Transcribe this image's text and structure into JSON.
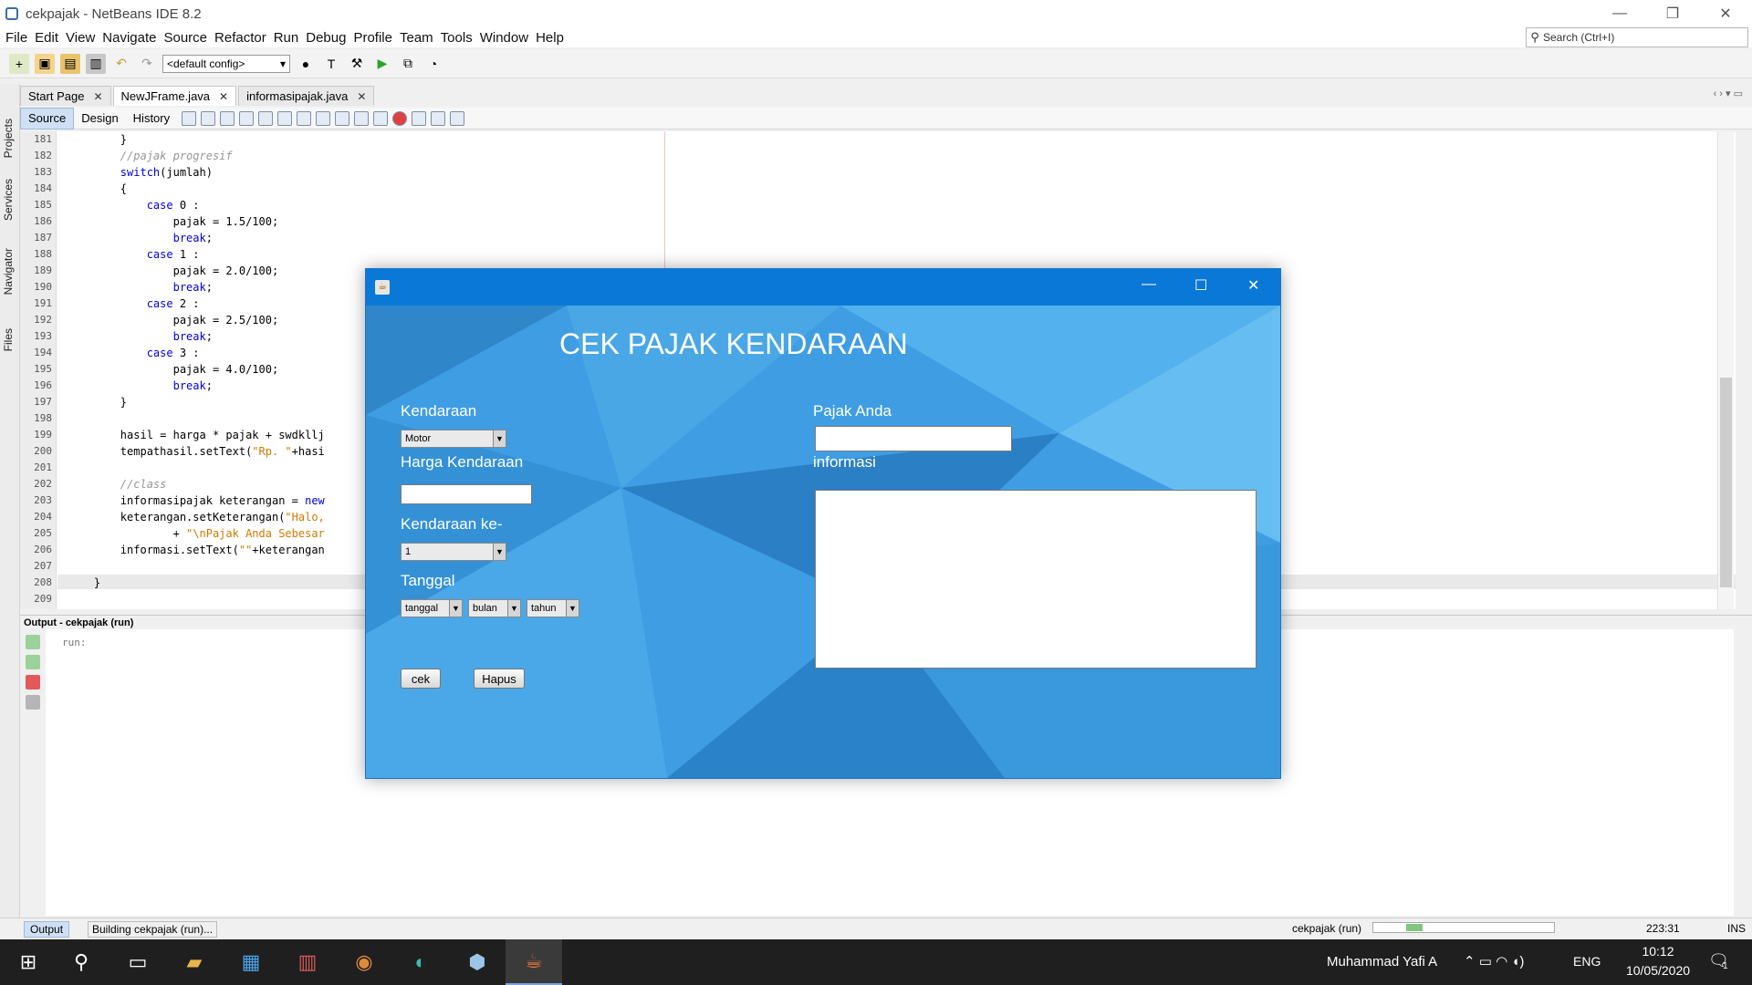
{
  "window": {
    "title": "cekpajak - NetBeans IDE 8.2",
    "minimize": "—",
    "restore": "❐",
    "close": "✕"
  },
  "menu": [
    "File",
    "Edit",
    "View",
    "Navigate",
    "Source",
    "Refactor",
    "Run",
    "Debug",
    "Profile",
    "Team",
    "Tools",
    "Window",
    "Help"
  ],
  "search": {
    "placeholder": "Search (Ctrl+I)"
  },
  "toolbar": {
    "config": "<default config>"
  },
  "left_strip": [
    "Projects",
    "Services",
    "Navigator",
    "Files"
  ],
  "editor_tabs": [
    {
      "label": "Start Page"
    },
    {
      "label": "NewJFrame.java"
    },
    {
      "label": "informasipajak.java"
    }
  ],
  "editor_views": [
    "Source",
    "Design",
    "History"
  ],
  "code_lines": [
    {
      "n": "181",
      "t": "        }"
    },
    {
      "n": "182",
      "t": "        //pajak progresif"
    },
    {
      "n": "183",
      "t": "        switch(jumlah)"
    },
    {
      "n": "184",
      "t": "        {"
    },
    {
      "n": "185",
      "t": "            case 0 :"
    },
    {
      "n": "186",
      "t": "                pajak = 1.5/100;"
    },
    {
      "n": "187",
      "t": "                break;"
    },
    {
      "n": "188",
      "t": "            case 1 :"
    },
    {
      "n": "189",
      "t": "                pajak = 2.0/100;"
    },
    {
      "n": "190",
      "t": "                break;"
    },
    {
      "n": "191",
      "t": "            case 2 :"
    },
    {
      "n": "192",
      "t": "                pajak = 2.5/100;"
    },
    {
      "n": "193",
      "t": "                break;"
    },
    {
      "n": "194",
      "t": "            case 3 :"
    },
    {
      "n": "195",
      "t": "                pajak = 4.0/100;"
    },
    {
      "n": "196",
      "t": "                break;"
    },
    {
      "n": "197",
      "t": "        }"
    },
    {
      "n": "198",
      "t": ""
    },
    {
      "n": "199",
      "t": "        hasil = harga * pajak + swdkllj"
    },
    {
      "n": "200",
      "t": "        tempathasil.setText(\"Rp. \"+hasi"
    },
    {
      "n": "201",
      "t": ""
    },
    {
      "n": "202",
      "t": "        //class"
    },
    {
      "n": "203",
      "t": "        informasipajak keterangan = new"
    },
    {
      "n": "204",
      "t": "        keterangan.setKeterangan(\"Halo,"
    },
    {
      "n": "205",
      "t": "                + \"\\nPajak Anda Sebesar"
    },
    {
      "n": "206",
      "t": "        informasi.setText(\"\"+keterangan"
    },
    {
      "n": "207",
      "t": ""
    },
    {
      "n": "208",
      "t": "    }"
    },
    {
      "n": "209",
      "t": ""
    }
  ],
  "output": {
    "title": "Output - cekpajak (run)",
    "text": "run:"
  },
  "status": {
    "output_tab": "Output",
    "building": "Building cekpajak (run)...",
    "project": "cekpajak (run)",
    "position": "223:31",
    "mode": "INS"
  },
  "app": {
    "title": "CEK PAJAK KENDARAAN",
    "kendaraan_label": "Kendaraan",
    "kendaraan_value": "Motor",
    "harga_label": "Harga Kendaraan",
    "ke_label": "Kendaraan ke-",
    "ke_value": "1",
    "tanggal_label": "Tanggal",
    "tanggal_value": "tanggal",
    "bulan_value": "bulan",
    "tahun_value": "tahun",
    "pajak_label": "Pajak Anda",
    "informasi_label": "informasi",
    "cek_button": "cek",
    "hapus_button": "Hapus"
  },
  "taskbar": {
    "user": "Muhammad Yafi A",
    "lang": "ENG",
    "time": "10:12",
    "date": "10/05/2020",
    "notif": "1"
  },
  "colors": {
    "app_title_bar": "#0a78d7",
    "app_bg": "#3f9de3",
    "taskbar": "#1f1f1f"
  }
}
